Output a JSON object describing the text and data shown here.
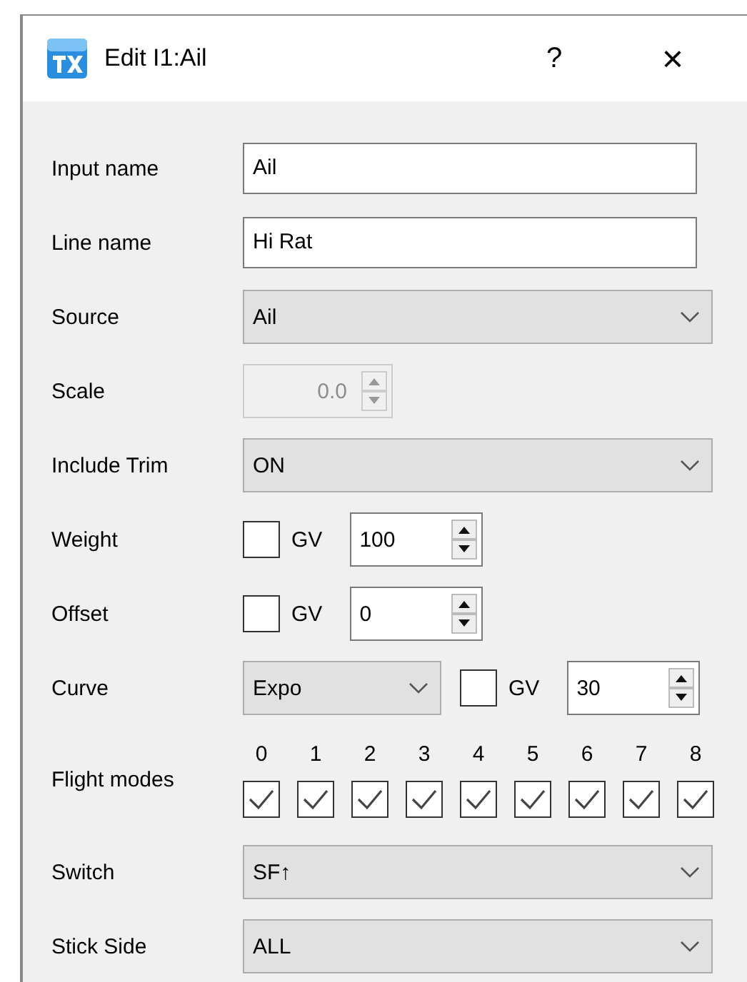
{
  "window": {
    "title": "Edit I1:Ail",
    "help": "?",
    "close": "×"
  },
  "rows": [
    {
      "kind": "text",
      "label": "Input name",
      "value": "Ail"
    },
    {
      "kind": "text",
      "label": "Line name",
      "value": "Hi Rat"
    },
    {
      "kind": "combo",
      "label": "Source",
      "value": "Ail"
    },
    {
      "kind": "spin",
      "label": "Scale",
      "value": "0.0",
      "disabled": true
    },
    {
      "kind": "combo",
      "label": "Include Trim",
      "value": "ON"
    },
    {
      "kind": "gv",
      "label": "Weight",
      "gv_label": "GV",
      "gv_checked": false,
      "value": "100"
    },
    {
      "kind": "gv",
      "label": "Offset",
      "gv_label": "GV",
      "gv_checked": false,
      "value": "0"
    },
    {
      "kind": "curve",
      "label": "Curve",
      "curve_type": "Expo",
      "gv_label": "GV",
      "gv_checked": false,
      "value": "30"
    },
    {
      "kind": "modes",
      "label": "Flight modes",
      "modes": [
        {
          "label": "0",
          "checked": true
        },
        {
          "label": "1",
          "checked": true
        },
        {
          "label": "2",
          "checked": true
        },
        {
          "label": "3",
          "checked": true
        },
        {
          "label": "4",
          "checked": true
        },
        {
          "label": "5",
          "checked": true
        },
        {
          "label": "6",
          "checked": true
        },
        {
          "label": "7",
          "checked": true
        },
        {
          "label": "8",
          "checked": true
        }
      ]
    },
    {
      "kind": "combo",
      "label": "Switch",
      "value": "SF↑"
    },
    {
      "kind": "combo",
      "label": "Stick Side",
      "value": "ALL"
    }
  ]
}
